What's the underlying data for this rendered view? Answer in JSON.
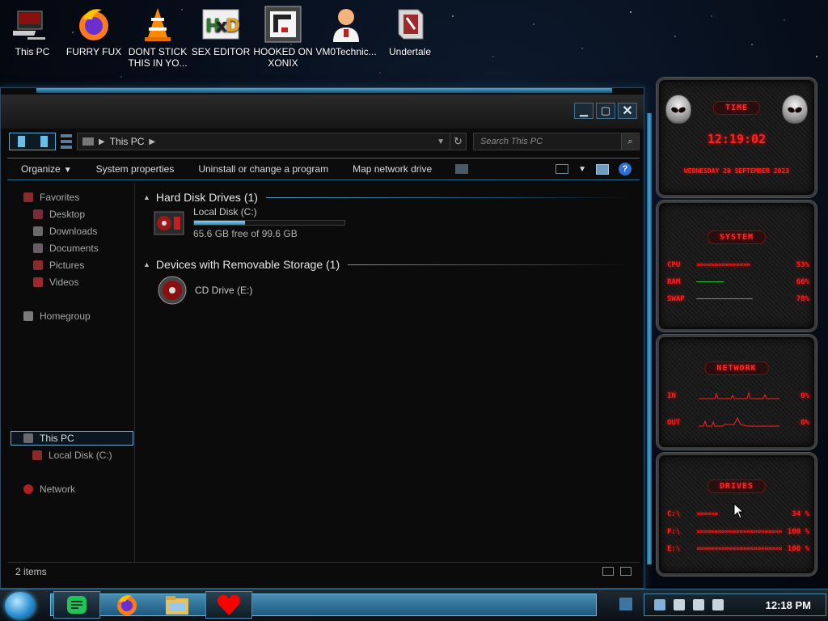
{
  "desktop": {
    "icons": [
      {
        "label": "This PC"
      },
      {
        "label": "FURRY FUX"
      },
      {
        "label": "DONT STICK THIS IN YO..."
      },
      {
        "label": "SEX EDITOR"
      },
      {
        "label": "HOOKED ON XONIX"
      },
      {
        "label": "VM0Technic..."
      },
      {
        "label": "Undertale"
      }
    ]
  },
  "explorer": {
    "address": {
      "location": "This PC"
    },
    "search": {
      "placeholder": "Search This PC"
    },
    "commands": {
      "organize": "Organize",
      "system_properties": "System properties",
      "uninstall": "Uninstall or change a program",
      "map_drive": "Map network drive"
    },
    "nav": {
      "favorites": "Favorites",
      "desktop": "Desktop",
      "downloads": "Downloads",
      "documents": "Documents",
      "pictures": "Pictures",
      "videos": "Videos",
      "homegroup": "Homegroup",
      "this_pc": "This PC",
      "local_disk": "Local Disk (C:)",
      "network": "Network"
    },
    "groups": {
      "hdd": "Hard Disk Drives (1)",
      "removable": "Devices with Removable Storage (1)"
    },
    "drives": {
      "c": {
        "name": "Local Disk (C:)",
        "free": "65.6 GB free of 99.6 GB",
        "used_fraction": 0.34
      },
      "e": {
        "name": "CD Drive (E:)"
      }
    },
    "status": {
      "items": "2 items"
    }
  },
  "widgets": {
    "time": {
      "title": "TIME",
      "time": "12:19:02",
      "date": "WEDNESDAY 20 SEPTEMBER 2023"
    },
    "system": {
      "title": "SYSTEM",
      "rows": [
        {
          "label": "CPU",
          "value": "53%",
          "arrows": "»»»»»»»»»»»»»»»"
        },
        {
          "label": "RAM",
          "value": "66%",
          "arrows": ""
        },
        {
          "label": "SWAP",
          "value": "78%",
          "arrows": ""
        }
      ]
    },
    "network": {
      "title": "NETWORK",
      "rows": [
        {
          "label": "IN",
          "value": "0%"
        },
        {
          "label": "OUT",
          "value": "0%"
        }
      ]
    },
    "drives": {
      "title": "DRIVES",
      "rows": [
        {
          "label": "C:\\",
          "value": "34 %",
          "arrows": "»»»»»»"
        },
        {
          "label": "F:\\",
          "value": "100 %",
          "arrows": "»»»»»»»»»»»»»»»»»»»»»»»»»"
        },
        {
          "label": "E:\\",
          "value": "100 %",
          "arrows": "»»»»»»»»»»»»»»»»»»»»»»»»»"
        }
      ]
    }
  },
  "taskbar": {
    "clock": "12:18 PM"
  },
  "colors": {
    "accent_blue": "#4aa6d4",
    "widget_red": "#ff2020"
  }
}
